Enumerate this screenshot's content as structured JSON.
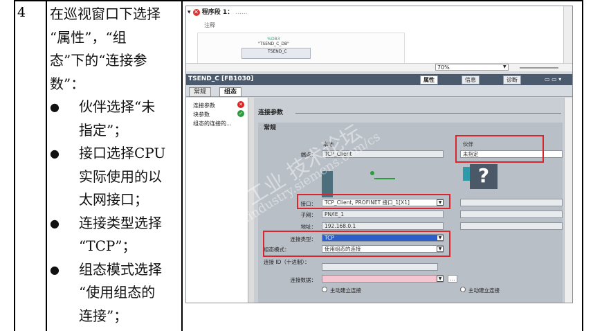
{
  "step": {
    "number": "4",
    "intro": "在巡视窗口下选择“属性”，“组态”下的“连接参数”：",
    "intro_lines": [
      "在巡视窗口下选择",
      "“属性”，“组",
      "态”下的“连接参",
      "数”："
    ],
    "bullets": [
      {
        "lines": [
          "伙伴选择“未",
          "指定”；"
        ]
      },
      {
        "lines": [
          "接口选择CPU",
          "实际使用的以",
          "太网接口；"
        ]
      },
      {
        "lines": [
          "连接类型选择",
          "“TCP”；"
        ]
      },
      {
        "lines": [
          "组态模式选择",
          "“使用组态的",
          "连接”；"
        ]
      }
    ]
  },
  "screenshot": {
    "network_title": "程序段 1：",
    "network_title_suffix": "......",
    "comment": "注释",
    "fb_instance": "%DB3",
    "fb_instance_name": "\"TSEND_C_DB\"",
    "fb_name": "TSEND_C",
    "zoom": "70%",
    "inspector_title": "TSEND_C [FB1030]",
    "tabs": {
      "properties": "属性",
      "info": "信息",
      "diagnostics": "诊断"
    },
    "sub_tabs": {
      "general": "常规",
      "config": "组态"
    },
    "nav_items": [
      "连接参数",
      "块参数",
      "组态的连接的..."
    ],
    "section": "连接参数",
    "subsection": "常规",
    "col_local": "本地",
    "col_partner": "伙伴",
    "endpoint_label": "端点：",
    "endpoint_local": "TCP_Client",
    "endpoint_partner": "未指定",
    "interface_label": "接口：",
    "interface_value": "TCP_Client, PROFINET 接口_1[X1]",
    "subnet_label": "子网：",
    "subnet_value": "PN/IE_1",
    "address_label": "地址：",
    "address_value": "192.168.0.1",
    "conn_type_label": "连接类型：",
    "conn_type_value": "TCP",
    "config_mode_label": "组态模式：",
    "config_mode_value": "使用组态的连接",
    "conn_id_label": "连接 ID（十进制）：",
    "conn_data_label": "连接数据：",
    "active_local": "主动建立连接",
    "active_partner": "主动建立连接",
    "question_mark": "?",
    "watermark_cn": "西门子工业 技术论坛",
    "watermark_en": "support.industry.siemens.com/cs"
  },
  "colors": {
    "highlight_red": "#d9262c",
    "selected_blue": "#2e5fc9",
    "pink": "#f4c6d1"
  }
}
